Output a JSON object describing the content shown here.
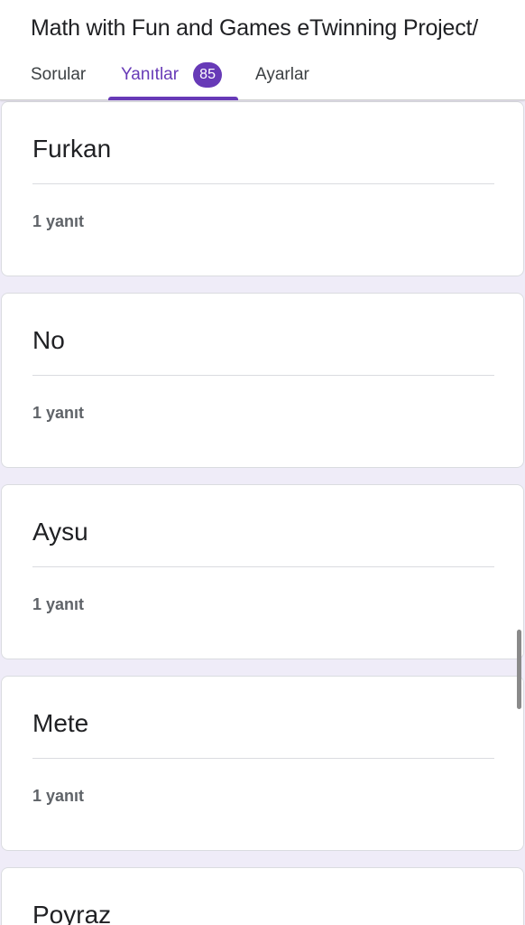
{
  "header": {
    "title": "Math with Fun and Games eTwinning Project/"
  },
  "tabs": {
    "questions": "Sorular",
    "responses": "Yanıtlar",
    "responses_count": "85",
    "settings": "Ayarlar"
  },
  "cards": [
    {
      "title": "Furkan",
      "count": "1 yanıt"
    },
    {
      "title": "No",
      "count": "1 yanıt"
    },
    {
      "title": "Aysu",
      "count": "1 yanıt"
    },
    {
      "title": "Mete",
      "count": "1 yanıt"
    },
    {
      "title": "Poyraz",
      "count": ""
    }
  ],
  "colors": {
    "accent": "#673ab7",
    "background": "#efecf8"
  }
}
